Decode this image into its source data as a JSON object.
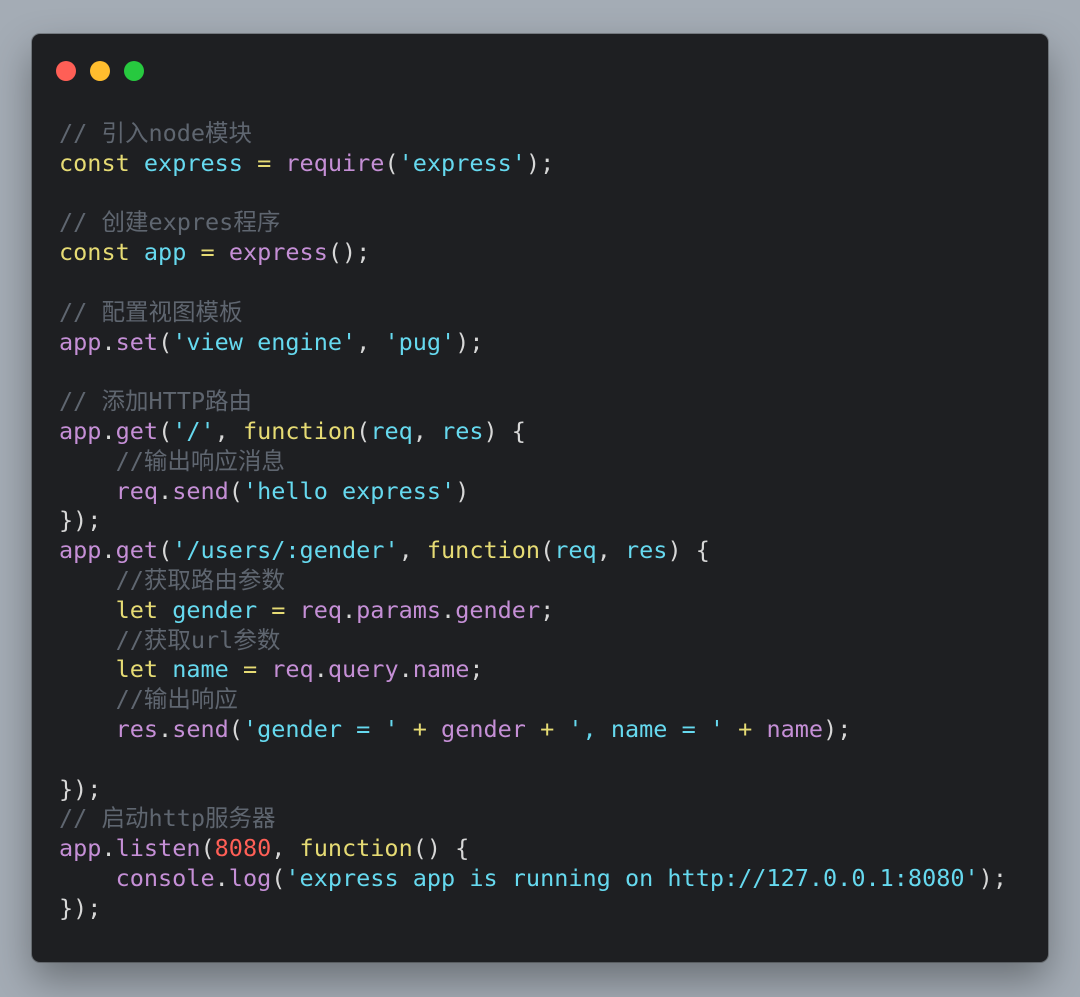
{
  "window": {
    "controls": [
      {
        "name": "close",
        "color": "#ff5f56"
      },
      {
        "name": "minimize",
        "color": "#ffbd2e"
      },
      {
        "name": "maximize",
        "color": "#27c93f"
      }
    ]
  },
  "code": {
    "lines": [
      [
        {
          "t": "// 引入node模块",
          "c": "c"
        }
      ],
      [
        {
          "t": "const",
          "c": "k"
        },
        {
          "t": " ",
          "c": "p"
        },
        {
          "t": "express",
          "c": "v"
        },
        {
          "t": " = ",
          "c": "o"
        },
        {
          "t": "require",
          "c": "f"
        },
        {
          "t": "(",
          "c": "p"
        },
        {
          "t": "'express'",
          "c": "s"
        },
        {
          "t": ");",
          "c": "p"
        }
      ],
      [],
      [
        {
          "t": "// 创建expres程序",
          "c": "c"
        }
      ],
      [
        {
          "t": "const",
          "c": "k"
        },
        {
          "t": " ",
          "c": "p"
        },
        {
          "t": "app",
          "c": "v"
        },
        {
          "t": " = ",
          "c": "o"
        },
        {
          "t": "express",
          "c": "f"
        },
        {
          "t": "();",
          "c": "p"
        }
      ],
      [],
      [
        {
          "t": "// 配置视图模板",
          "c": "c"
        }
      ],
      [
        {
          "t": "app",
          "c": "f"
        },
        {
          "t": ".",
          "c": "p"
        },
        {
          "t": "set",
          "c": "f"
        },
        {
          "t": "(",
          "c": "p"
        },
        {
          "t": "'view engine'",
          "c": "s"
        },
        {
          "t": ", ",
          "c": "p"
        },
        {
          "t": "'pug'",
          "c": "s"
        },
        {
          "t": ");",
          "c": "p"
        }
      ],
      [],
      [
        {
          "t": "// 添加HTTP路由",
          "c": "c"
        }
      ],
      [
        {
          "t": "app",
          "c": "f"
        },
        {
          "t": ".",
          "c": "p"
        },
        {
          "t": "get",
          "c": "f"
        },
        {
          "t": "(",
          "c": "p"
        },
        {
          "t": "'/'",
          "c": "s"
        },
        {
          "t": ", ",
          "c": "p"
        },
        {
          "t": "function",
          "c": "k"
        },
        {
          "t": "(",
          "c": "p"
        },
        {
          "t": "req",
          "c": "v"
        },
        {
          "t": ", ",
          "c": "p"
        },
        {
          "t": "res",
          "c": "v"
        },
        {
          "t": ") {",
          "c": "p"
        }
      ],
      [
        {
          "t": "    //输出响应消息",
          "c": "c"
        }
      ],
      [
        {
          "t": "    ",
          "c": "p"
        },
        {
          "t": "req",
          "c": "f"
        },
        {
          "t": ".",
          "c": "p"
        },
        {
          "t": "send",
          "c": "f"
        },
        {
          "t": "(",
          "c": "p"
        },
        {
          "t": "'hello express'",
          "c": "s"
        },
        {
          "t": ")",
          "c": "p"
        }
      ],
      [
        {
          "t": "});",
          "c": "p"
        }
      ],
      [
        {
          "t": "app",
          "c": "f"
        },
        {
          "t": ".",
          "c": "p"
        },
        {
          "t": "get",
          "c": "f"
        },
        {
          "t": "(",
          "c": "p"
        },
        {
          "t": "'/users/:gender'",
          "c": "s"
        },
        {
          "t": ", ",
          "c": "p"
        },
        {
          "t": "function",
          "c": "k"
        },
        {
          "t": "(",
          "c": "p"
        },
        {
          "t": "req",
          "c": "v"
        },
        {
          "t": ", ",
          "c": "p"
        },
        {
          "t": "res",
          "c": "v"
        },
        {
          "t": ") {",
          "c": "p"
        }
      ],
      [
        {
          "t": "    //获取路由参数",
          "c": "c"
        }
      ],
      [
        {
          "t": "    ",
          "c": "p"
        },
        {
          "t": "let",
          "c": "k"
        },
        {
          "t": " ",
          "c": "p"
        },
        {
          "t": "gender",
          "c": "v"
        },
        {
          "t": " = ",
          "c": "o"
        },
        {
          "t": "req",
          "c": "f"
        },
        {
          "t": ".",
          "c": "p"
        },
        {
          "t": "params",
          "c": "f"
        },
        {
          "t": ".",
          "c": "p"
        },
        {
          "t": "gender",
          "c": "f"
        },
        {
          "t": ";",
          "c": "p"
        }
      ],
      [
        {
          "t": "    //获取url参数",
          "c": "c"
        }
      ],
      [
        {
          "t": "    ",
          "c": "p"
        },
        {
          "t": "let",
          "c": "k"
        },
        {
          "t": " ",
          "c": "p"
        },
        {
          "t": "name",
          "c": "v"
        },
        {
          "t": " = ",
          "c": "o"
        },
        {
          "t": "req",
          "c": "f"
        },
        {
          "t": ".",
          "c": "p"
        },
        {
          "t": "query",
          "c": "f"
        },
        {
          "t": ".",
          "c": "p"
        },
        {
          "t": "name",
          "c": "f"
        },
        {
          "t": ";",
          "c": "p"
        }
      ],
      [
        {
          "t": "    //输出响应",
          "c": "c"
        }
      ],
      [
        {
          "t": "    ",
          "c": "p"
        },
        {
          "t": "res",
          "c": "f"
        },
        {
          "t": ".",
          "c": "p"
        },
        {
          "t": "send",
          "c": "f"
        },
        {
          "t": "(",
          "c": "p"
        },
        {
          "t": "'gender = '",
          "c": "s"
        },
        {
          "t": " + ",
          "c": "o"
        },
        {
          "t": "gender",
          "c": "f"
        },
        {
          "t": " + ",
          "c": "o"
        },
        {
          "t": "', name = '",
          "c": "s"
        },
        {
          "t": " + ",
          "c": "o"
        },
        {
          "t": "name",
          "c": "f"
        },
        {
          "t": ");",
          "c": "p"
        }
      ],
      [],
      [
        {
          "t": "});",
          "c": "p"
        }
      ],
      [
        {
          "t": "// 启动http服务器",
          "c": "c"
        }
      ],
      [
        {
          "t": "app",
          "c": "f"
        },
        {
          "t": ".",
          "c": "p"
        },
        {
          "t": "listen",
          "c": "f"
        },
        {
          "t": "(",
          "c": "p"
        },
        {
          "t": "8080",
          "c": "n"
        },
        {
          "t": ", ",
          "c": "p"
        },
        {
          "t": "function",
          "c": "k"
        },
        {
          "t": "() {",
          "c": "p"
        }
      ],
      [
        {
          "t": "    ",
          "c": "p"
        },
        {
          "t": "console",
          "c": "f"
        },
        {
          "t": ".",
          "c": "p"
        },
        {
          "t": "log",
          "c": "f"
        },
        {
          "t": "(",
          "c": "p"
        },
        {
          "t": "'express app is running on http://127.0.0.1:8080'",
          "c": "s"
        },
        {
          "t": ");",
          "c": "p"
        }
      ],
      [
        {
          "t": "});",
          "c": "p"
        }
      ]
    ]
  }
}
